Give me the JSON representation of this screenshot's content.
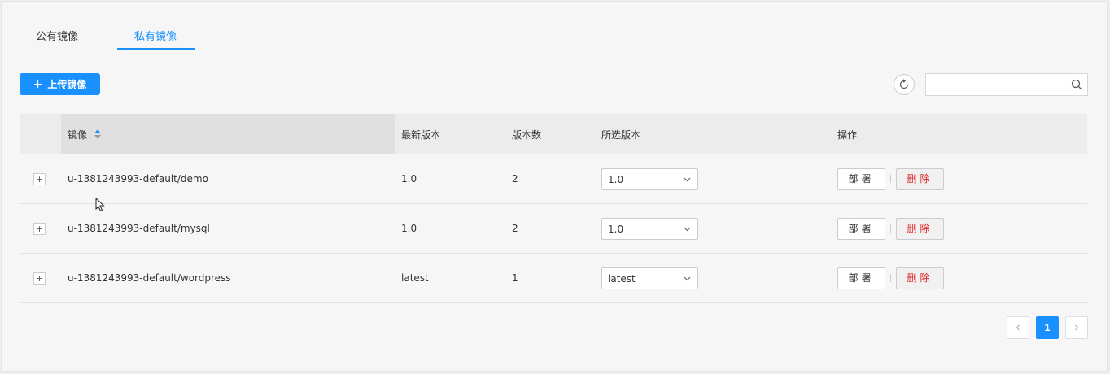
{
  "tabs": [
    {
      "label": "公有镜像",
      "active": false
    },
    {
      "label": "私有镜像",
      "active": true
    }
  ],
  "toolbar": {
    "upload_label": "上传镜像",
    "search_placeholder": ""
  },
  "table": {
    "headers": {
      "image": "镜像",
      "latest_version": "最新版本",
      "version_count": "版本数",
      "selected_version": "所选版本",
      "actions": "操作"
    },
    "rows": [
      {
        "image": "u-1381243993-default/demo",
        "latest_version": "1.0",
        "version_count": "2",
        "selected_version": "1.0",
        "deploy": "部署",
        "delete": "删除"
      },
      {
        "image": "u-1381243993-default/mysql",
        "latest_version": "1.0",
        "version_count": "2",
        "selected_version": "1.0",
        "deploy": "部署",
        "delete": "删除"
      },
      {
        "image": "u-1381243993-default/wordpress",
        "latest_version": "latest",
        "version_count": "1",
        "selected_version": "latest",
        "deploy": "部署",
        "delete": "删除"
      }
    ]
  },
  "pagination": {
    "current_page": "1",
    "prev_icon": "chevron-left-icon",
    "next_icon": "chevron-right-icon"
  },
  "colors": {
    "accent": "#1890ff",
    "danger": "#e02020"
  }
}
